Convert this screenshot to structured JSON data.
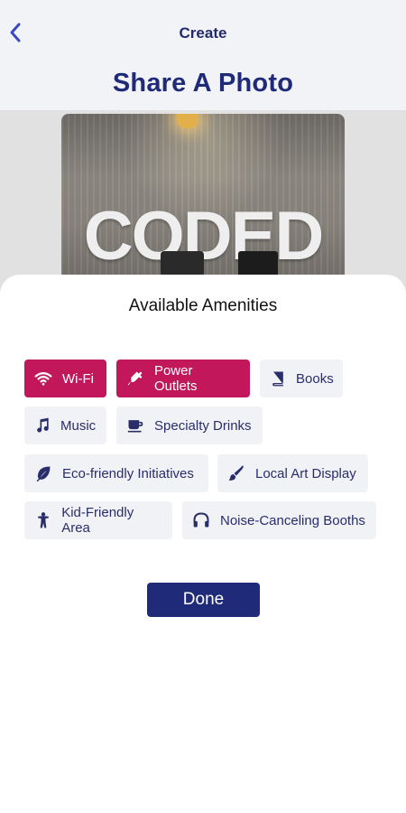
{
  "header": {
    "nav_title": "Create",
    "page_title": "Share A Photo"
  },
  "photo": {
    "sign_text": "CODED"
  },
  "amenities": {
    "title": "Available Amenities",
    "items": [
      {
        "label": "Wi-Fi",
        "icon": "wifi-icon",
        "selected": true
      },
      {
        "label": "Power Outlets",
        "icon": "plug-icon",
        "selected": true
      },
      {
        "label": "Books",
        "icon": "book-icon",
        "selected": false
      },
      {
        "label": "Music",
        "icon": "music-note-icon",
        "selected": false
      },
      {
        "label": "Specialty Drinks",
        "icon": "coffee-cup-icon",
        "selected": false
      },
      {
        "label": "Eco-friendly Initiatives",
        "icon": "leaf-icon",
        "selected": false
      },
      {
        "label": "Local Art Display",
        "icon": "paint-brush-icon",
        "selected": false
      },
      {
        "label": "Kid-Friendly Area",
        "icon": "child-icon",
        "selected": false
      },
      {
        "label": "Noise-Canceling Booths",
        "icon": "headphones-icon",
        "selected": false
      }
    ],
    "done_label": "Done"
  },
  "colors": {
    "accent": "#c2185b",
    "primary": "#1f2a78",
    "chip_bg": "#f1f2f6"
  }
}
